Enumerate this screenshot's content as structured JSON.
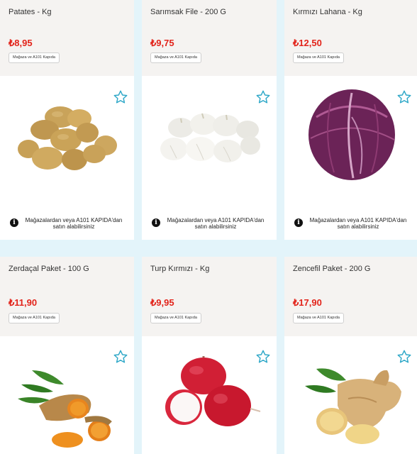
{
  "products": [
    {
      "title": "Patates - Kg",
      "price": "₺8,95",
      "badge": "Mağaza ve A101 Kapıda",
      "note": "Mağazalardan veya A101 KAPIDA'dan satın alabilirsiniz",
      "image": "potatoes",
      "icon": "star-icon"
    },
    {
      "title": "Sarımsak File - 200 G",
      "price": "₺9,75",
      "badge": "Mağaza ve A101 Kapıda",
      "note": "Mağazalardan veya A101 KAPIDA'dan satın alabilirsiniz",
      "image": "garlic",
      "icon": "star-icon"
    },
    {
      "title": "Kırmızı Lahana - Kg",
      "price": "₺12,50",
      "badge": "Mağaza ve A101 Kapıda",
      "note": "Mağazalardan veya A101 KAPIDA'dan satın alabilirsiniz",
      "image": "red-cabbage",
      "icon": "star-icon"
    },
    {
      "title": "Zerdaçal Paket - 100 G",
      "price": "₺11,90",
      "badge": "Mağaza ve A101 Kapıda",
      "image": "turmeric",
      "icon": "star-icon"
    },
    {
      "title": "Turp Kırmızı - Kg",
      "price": "₺9,95",
      "badge": "Mağaza ve A101 Kapıda",
      "image": "red-radish",
      "icon": "star-icon"
    },
    {
      "title": "Zencefil Paket - 200 G",
      "price": "₺17,90",
      "badge": "Mağaza ve A101 Kapıda",
      "image": "ginger",
      "icon": "star-icon"
    }
  ],
  "colors": {
    "price": "#e2231a",
    "star": "#2fa8c8",
    "page_bg": "#e3f4fa",
    "card_head": "#f5f3f1"
  }
}
